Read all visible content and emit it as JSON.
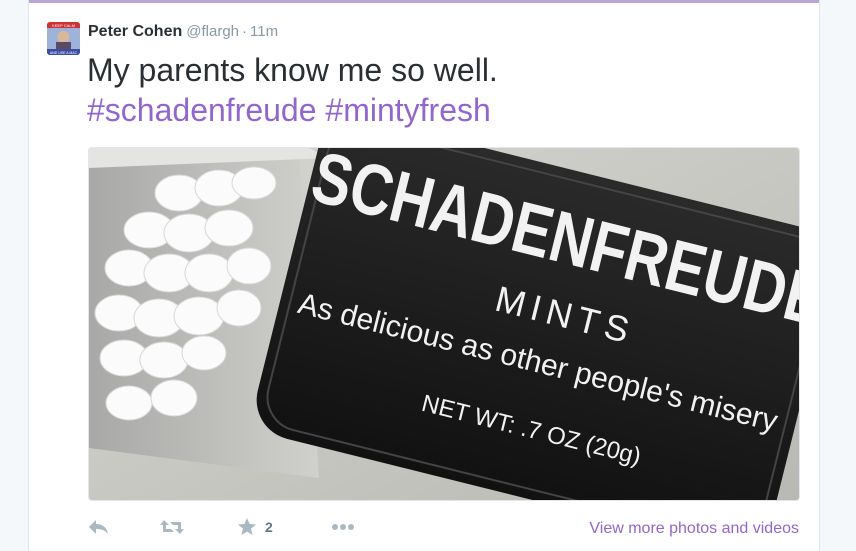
{
  "tweet": {
    "author_name": "Peter Cohen",
    "handle": "@flargh",
    "separator": "·",
    "time": "11m",
    "text_line1": "My parents know me so well.",
    "hashtags": [
      "#schadenfreude",
      "#mintyfresh"
    ]
  },
  "photo": {
    "tin_title": "SCHADENFREUDE",
    "tin_subtitle": "MINTS",
    "tin_tagline": "As delicious as other people's misery",
    "tin_weight": "NET WT: .7 OZ (20g)"
  },
  "avatar": {
    "top_text": "KEEP CALM",
    "bottom_text": "AND USE A MAC"
  },
  "actions": {
    "favorite_count": "2",
    "view_more": "View more photos and videos"
  },
  "colors": {
    "hashtag": "#9266cc",
    "action_icon": "#aab8c2",
    "top_border": "#b9a6d6"
  },
  "icons": [
    "reply-icon",
    "retweet-icon",
    "favorite-star-icon",
    "more-dots-icon"
  ]
}
